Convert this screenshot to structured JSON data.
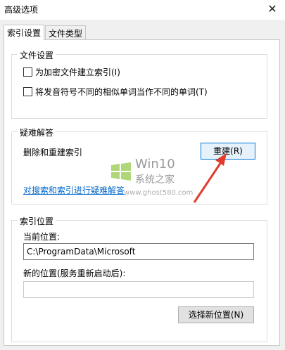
{
  "window": {
    "title": "高级选项",
    "close_glyph": "✕"
  },
  "tabs": [
    {
      "label": "索引设置",
      "active": true
    },
    {
      "label": "文件类型",
      "active": false
    }
  ],
  "file_settings": {
    "title": "文件设置",
    "options": [
      {
        "label": "为加密文件建立索引(I)",
        "checked": false
      },
      {
        "label": "将发音符号不同的相似单词当作不同的单词(T)",
        "checked": false
      }
    ]
  },
  "troubleshooting": {
    "title": "疑难解答",
    "rebuild_text": "删除和重建索引",
    "rebuild_button": "重建(R)",
    "help_link": "对搜索和索引进行疑难解答"
  },
  "index_location": {
    "title": "索引位置",
    "current_label": "当前位置:",
    "current_value": "C:\\ProgramData\\Microsoft",
    "new_label": "新的位置(服务重新启动后):",
    "new_value": "",
    "select_button": "选择新位置(N)"
  },
  "watermark": {
    "win10": "Win10",
    "win10_sub": "系统之家",
    "url": "www.ghost580.com"
  },
  "colors": {
    "accent": "#0078d7",
    "link": "#0066cc",
    "arrow": "#e23b2e"
  }
}
